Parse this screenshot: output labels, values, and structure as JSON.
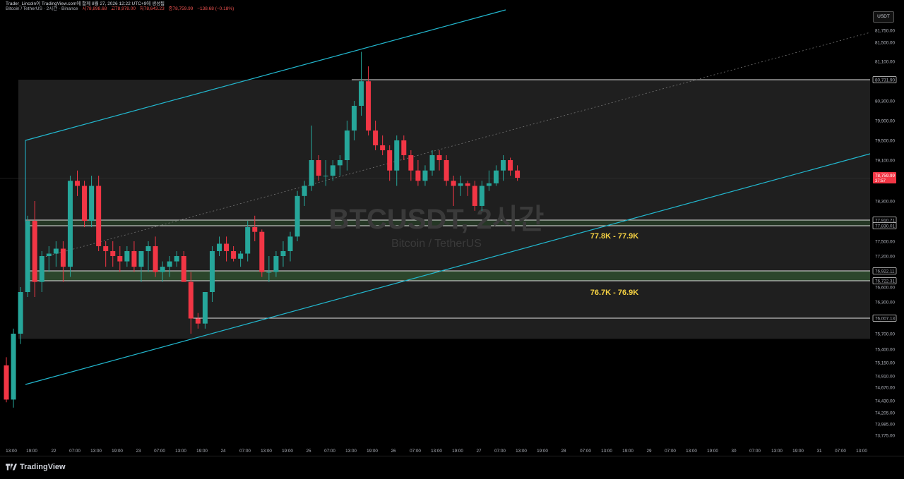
{
  "header": {
    "line1": "Trader_Lincoln이 TradingView.com에 함께 8월 27, 2026 12:22 UTC+9에 생성됨",
    "symbol": "Bitcoin / TetherUS · 2시간 · Binance",
    "open": "시78,898.68",
    "high": "고78,978.00",
    "low": "저78,643.23",
    "close": "종78,759.99",
    "change": "−138.68 (−0.18%)"
  },
  "currency_button": "USDT",
  "watermark": {
    "symbol": "BTCUSDT, 2시간",
    "name": "Bitcoin / TetherUS"
  },
  "annotations": {
    "zone_upper": "77.8K - 77.9K",
    "zone_lower": "76.7K - 76.9K"
  },
  "current_price": {
    "value": "78,759.99",
    "countdown": "37:57",
    "color": "#f23645"
  },
  "logo_text": "TradingView",
  "colors": {
    "up": "#26a69a",
    "down": "#f23645",
    "channel": "#22b8cf",
    "annotation": "#f5d142",
    "zone": "#2e4a2e"
  },
  "chart_data": {
    "type": "candlestick",
    "symbol": "BTCUSDT",
    "timeframe": "2시간",
    "y_ticks": [
      81750,
      81500,
      81100,
      80731.9,
      80300,
      79900,
      79500,
      79100,
      78300,
      77910.71,
      77830.01,
      77500,
      77200,
      76922.11,
      76722.31,
      76600,
      76300,
      76007.13,
      75700,
      75400,
      75150,
      74910,
      74670,
      74430,
      74205,
      73985,
      73775
    ],
    "y_tick_labels": [
      "81,750.00",
      "81,500.00",
      "81,100.00",
      "80,731.90",
      "80,300.00",
      "79,900.00",
      "79,500.00",
      "79,100.00",
      "78,300.00",
      "77,910.71",
      "77,830.01",
      "77,500.00",
      "77,200.00",
      "76,922.11",
      "76,722.31",
      "76,600.00",
      "76,300.00",
      "76,007.13",
      "75,700.00",
      "75,400.00",
      "75,150.00",
      "74,910.00",
      "74,670.00",
      "74,430.00",
      "74,205.00",
      "73,985.00",
      "73,775.00"
    ],
    "x_tick_labels": [
      "13:00",
      "19:00",
      "22",
      "07:00",
      "13:00",
      "19:00",
      "23",
      "07:00",
      "13:00",
      "19:00",
      "24",
      "07:00",
      "13:00",
      "19:00",
      "25",
      "07:00",
      "13:00",
      "19:00",
      "26",
      "07:00",
      "13:00",
      "19:00",
      "27",
      "07:00",
      "13:00",
      "19:00",
      "28",
      "07:00",
      "13:00",
      "19:00",
      "29",
      "07:00",
      "13:00",
      "19:00",
      "30",
      "07:00",
      "13:00",
      "19:00",
      "31",
      "07:00",
      "13:00"
    ],
    "candles": [
      [
        75100,
        75250,
        74400,
        74450
      ],
      [
        74450,
        75800,
        74300,
        75700
      ],
      [
        75700,
        76600,
        75500,
        76500
      ],
      [
        76500,
        78000,
        76400,
        77900
      ],
      [
        77900,
        78300,
        76400,
        76700
      ],
      [
        76700,
        77300,
        76500,
        77200
      ],
      [
        77200,
        77400,
        76900,
        77250
      ],
      [
        77250,
        77500,
        77000,
        77350
      ],
      [
        77350,
        77500,
        76700,
        77000
      ],
      [
        77000,
        78800,
        76800,
        78700
      ],
      [
        78700,
        78900,
        78400,
        78600
      ],
      [
        78600,
        78700,
        77800,
        77900
      ],
      [
        77900,
        78800,
        77800,
        78600
      ],
      [
        78600,
        78800,
        77300,
        77400
      ],
      [
        77400,
        77500,
        77000,
        77300
      ],
      [
        77300,
        77500,
        77000,
        77200
      ],
      [
        77200,
        77400,
        76900,
        77100
      ],
      [
        77100,
        77400,
        77000,
        77300
      ],
      [
        77300,
        77500,
        76900,
        77000
      ],
      [
        77000,
        77300,
        76700,
        77300
      ],
      [
        77300,
        77500,
        76900,
        77400
      ],
      [
        77400,
        77600,
        76800,
        76900
      ],
      [
        76900,
        77100,
        76700,
        77000
      ],
      [
        77000,
        77200,
        76800,
        77100
      ],
      [
        77100,
        77300,
        77000,
        77200
      ],
      [
        77200,
        77300,
        76900,
        76700
      ],
      [
        76700,
        76900,
        75700,
        76000
      ],
      [
        76000,
        76100,
        75800,
        75900
      ],
      [
        75900,
        76500,
        75800,
        76500
      ],
      [
        76500,
        77400,
        76300,
        77300
      ],
      [
        77300,
        77600,
        77200,
        77450
      ],
      [
        77450,
        77600,
        77100,
        77300
      ],
      [
        77300,
        77400,
        77100,
        77150
      ],
      [
        77150,
        77300,
        77000,
        77250
      ],
      [
        77250,
        77900,
        77100,
        77800
      ],
      [
        77800,
        78000,
        77500,
        77700
      ],
      [
        77700,
        77750,
        76800,
        76900
      ],
      [
        76900,
        77200,
        76700,
        76900
      ],
      [
        76900,
        77300,
        76800,
        77200
      ],
      [
        77200,
        77500,
        77000,
        77300
      ],
      [
        77300,
        77700,
        77100,
        77600
      ],
      [
        77600,
        78500,
        77500,
        78400
      ],
      [
        78400,
        78700,
        78200,
        78600
      ],
      [
        78600,
        79800,
        78500,
        79100
      ],
      [
        79100,
        79200,
        78700,
        78800
      ],
      [
        78800,
        79100,
        78600,
        78800
      ],
      [
        78800,
        79100,
        78700,
        79000
      ],
      [
        79000,
        79200,
        78800,
        79100
      ],
      [
        79100,
        79900,
        78900,
        79700
      ],
      [
        79700,
        80300,
        79500,
        80200
      ],
      [
        80200,
        81300,
        80000,
        80700
      ],
      [
        80700,
        81000,
        79600,
        79700
      ],
      [
        79700,
        79900,
        79300,
        79400
      ],
      [
        79400,
        79600,
        79200,
        79300
      ],
      [
        79300,
        79400,
        78700,
        78900
      ],
      [
        78900,
        79600,
        78600,
        79500
      ],
      [
        79500,
        79600,
        79100,
        79200
      ],
      [
        79200,
        79300,
        78700,
        78900
      ],
      [
        78900,
        79100,
        78600,
        78700
      ],
      [
        78700,
        79000,
        78600,
        78900
      ],
      [
        78900,
        79300,
        78800,
        79200
      ],
      [
        79200,
        79300,
        78900,
        79100
      ],
      [
        79100,
        79200,
        78600,
        78700
      ],
      [
        78700,
        78800,
        78200,
        78600
      ],
      [
        78600,
        78800,
        78400,
        78650
      ],
      [
        78650,
        78700,
        78400,
        78600
      ],
      [
        78600,
        78700,
        78100,
        78200
      ],
      [
        78200,
        78700,
        78100,
        78600
      ],
      [
        78600,
        78900,
        78500,
        78650
      ],
      [
        78650,
        79000,
        78600,
        78900
      ],
      [
        78900,
        79200,
        78700,
        79100
      ],
      [
        79100,
        79150,
        78800,
        78900
      ],
      [
        78900,
        79000,
        78700,
        78760
      ]
    ],
    "horizontal_levels": [
      80731.9,
      77910.71,
      77830.01,
      76922.11,
      76722.31,
      76007.13
    ],
    "zones": [
      {
        "top": 77910.71,
        "bottom": 77830.01,
        "label_key": "zone_upper"
      },
      {
        "top": 76922.11,
        "bottom": 76722.31,
        "label_key": "zone_lower"
      }
    ],
    "current_price": 78759.99
  }
}
